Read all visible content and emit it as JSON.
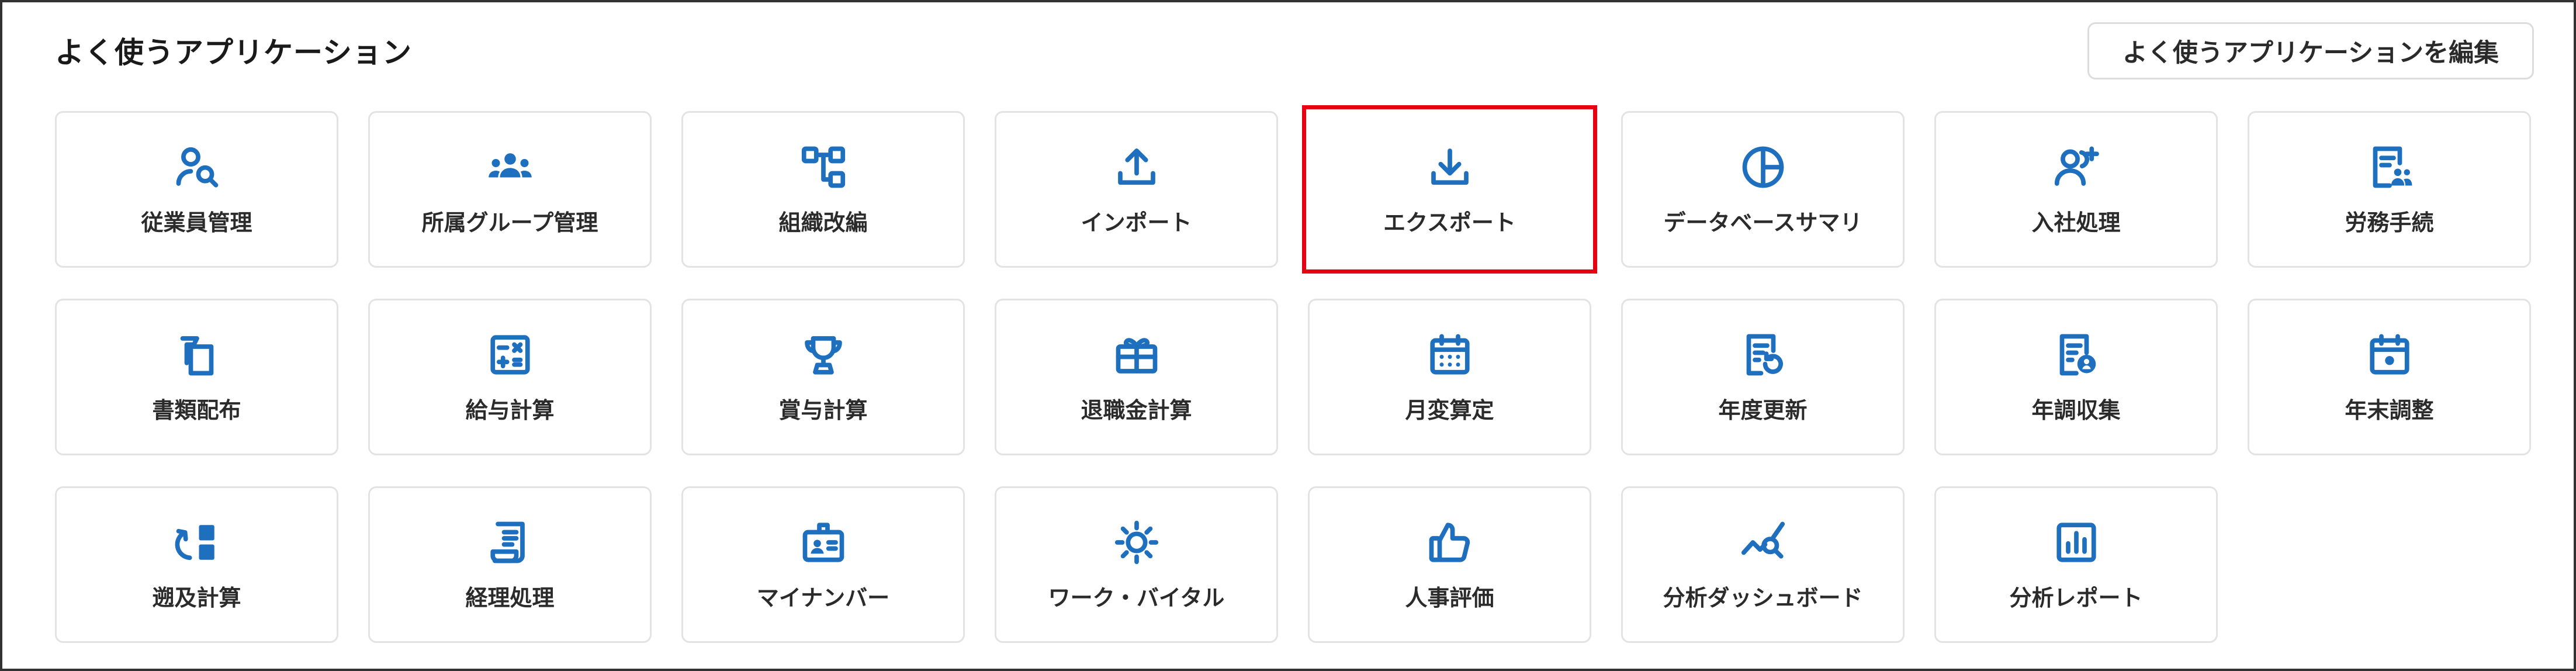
{
  "section": {
    "title": "よく使うアプリケーション",
    "edit_label": "よく使うアプリケーションを編集"
  },
  "accent_color": "#1f6fbf",
  "highlight_color": "#e60012",
  "apps": [
    {
      "label": "従業員管理",
      "icon": "person-search-icon"
    },
    {
      "label": "所属グループ管理",
      "icon": "group-icon"
    },
    {
      "label": "組織改編",
      "icon": "org-chart-icon"
    },
    {
      "label": "インポート",
      "icon": "upload-icon"
    },
    {
      "label": "エクスポート",
      "icon": "download-icon",
      "highlighted": true
    },
    {
      "label": "データベースサマリ",
      "icon": "pie-chart-icon"
    },
    {
      "label": "入社処理",
      "icon": "person-add-icon"
    },
    {
      "label": "労務手続",
      "icon": "labor-document-icon"
    },
    {
      "label": "書類配布",
      "icon": "document-stack-icon"
    },
    {
      "label": "給与計算",
      "icon": "calculator-icon"
    },
    {
      "label": "賞与計算",
      "icon": "trophy-icon"
    },
    {
      "label": "退職金計算",
      "icon": "gift-icon"
    },
    {
      "label": "月変算定",
      "icon": "calendar-grid-icon"
    },
    {
      "label": "年度更新",
      "icon": "document-refresh-icon"
    },
    {
      "label": "年調収集",
      "icon": "document-person-icon"
    },
    {
      "label": "年末調整",
      "icon": "calendar-event-icon"
    },
    {
      "label": "遡及計算",
      "icon": "retroactive-icon"
    },
    {
      "label": "経理処理",
      "icon": "receipt-icon"
    },
    {
      "label": "マイナンバー",
      "icon": "id-badge-icon"
    },
    {
      "label": "ワーク・バイタル",
      "icon": "sun-icon"
    },
    {
      "label": "人事評価",
      "icon": "thumbs-up-icon"
    },
    {
      "label": "分析ダッシュボード",
      "icon": "chart-search-icon"
    },
    {
      "label": "分析レポート",
      "icon": "bar-report-icon"
    }
  ]
}
